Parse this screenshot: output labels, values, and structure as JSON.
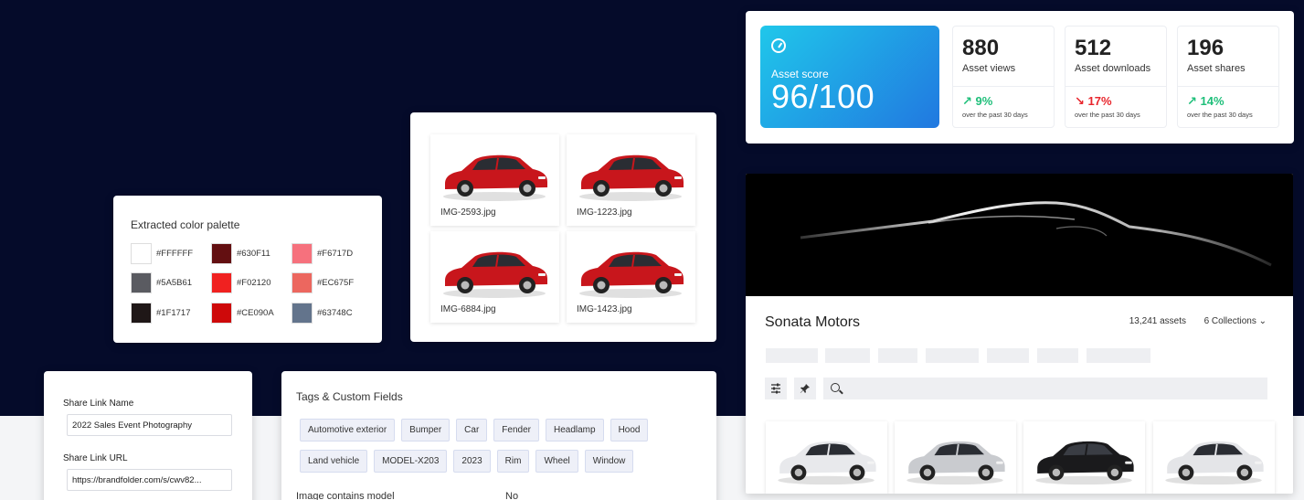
{
  "stats": {
    "score_label": "Asset score",
    "score_value": "96/100",
    "items": [
      {
        "number": "880",
        "label": "Asset views",
        "change": "↗ 9%",
        "direction": "up",
        "period": "over the past 30 days"
      },
      {
        "number": "512",
        "label": "Asset downloads",
        "change": "↘ 17%",
        "direction": "down",
        "period": "over the past 30 days"
      },
      {
        "number": "196",
        "label": "Asset shares",
        "change": "↗ 14%",
        "direction": "up",
        "period": "over the past 30 days"
      }
    ],
    "colors": {
      "up": "#1fbf7a",
      "down": "#e8262d"
    }
  },
  "palette": {
    "title": "Extracted color palette",
    "rows": [
      [
        {
          "hex": "#FFFFFF"
        },
        {
          "hex": "#630F11"
        },
        {
          "hex": "#F6717D"
        }
      ],
      [
        {
          "hex": "#5A5B61"
        },
        {
          "hex": "#F02120"
        },
        {
          "hex": "#EC675F"
        }
      ],
      [
        {
          "hex": "#1F1717"
        },
        {
          "hex": "#CE090A"
        },
        {
          "hex": "#63748C"
        }
      ]
    ]
  },
  "images": [
    {
      "name": "IMG-2593.jpg",
      "color": "#c8161c"
    },
    {
      "name": "IMG-1223.jpg",
      "color": "#c8161c"
    },
    {
      "name": "IMG-6884.jpg",
      "color": "#c8161c"
    },
    {
      "name": "IMG-1423.jpg",
      "color": "#c8161c"
    }
  ],
  "brand": {
    "name": "Sonata Motors",
    "asset_count": "13,241 assets",
    "collections": "6 Collections ⌄",
    "car_colors": [
      "#e8e9ec",
      "#c9cbcf",
      "#1a1a1c",
      "#e4e5e8"
    ]
  },
  "share": {
    "name_label": "Share Link Name",
    "name_value": "2022 Sales Event Photography",
    "url_label": "Share Link URL",
    "url_value": "https://brandfolder.com/s/cwv82..."
  },
  "tags": {
    "title": "Tags & Custom Fields",
    "row1": [
      "Automotive exterior",
      "Bumper",
      "Car",
      "Fender",
      "Headlamp",
      "Hood"
    ],
    "row2": [
      "Land vehicle",
      "MODEL-X203",
      "2023",
      "Rim",
      "Wheel",
      "Window"
    ],
    "field_label": "Image contains model",
    "field_value": "No"
  }
}
